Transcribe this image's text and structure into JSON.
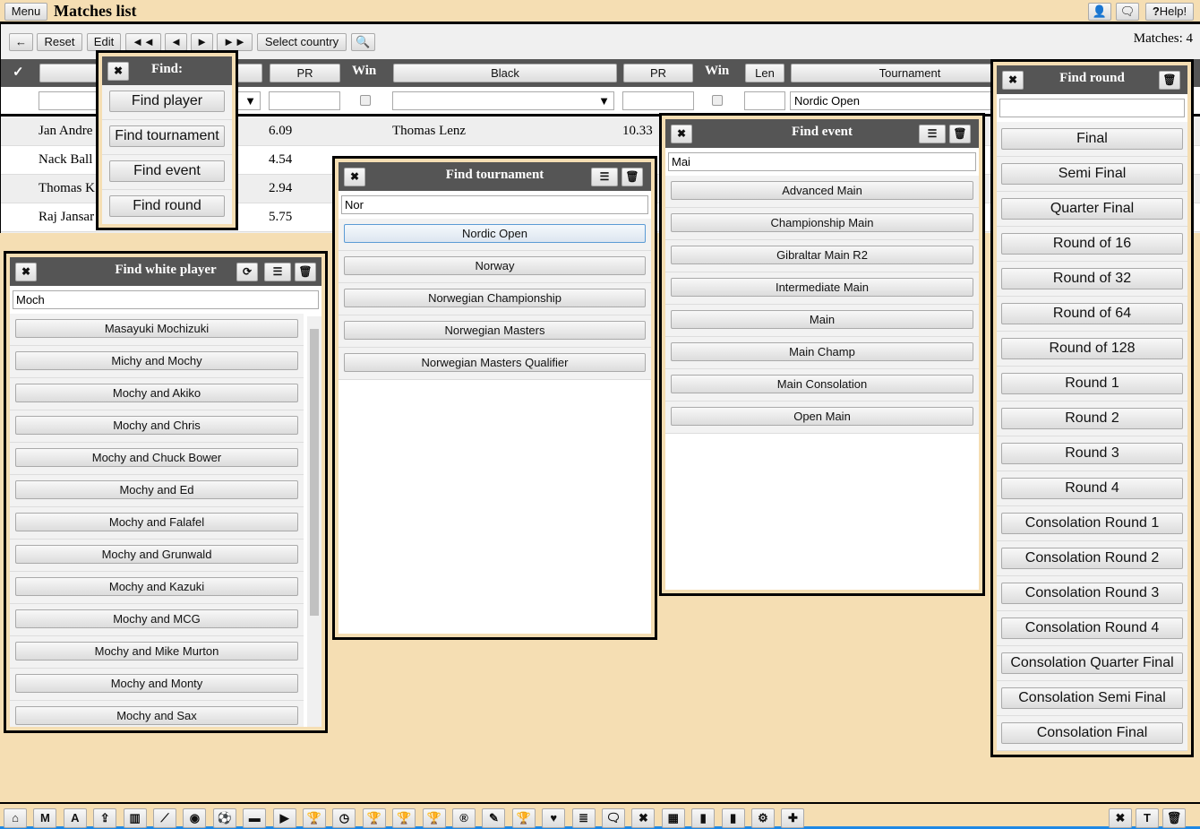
{
  "topbar": {
    "menu": "Menu",
    "title": "Matches list",
    "help": "Help!"
  },
  "toolbar": {
    "reset": "Reset",
    "edit": "Edit",
    "first": "◄◄",
    "prev": "◄",
    "next": "►",
    "last": "►►",
    "select_country": "Select country",
    "matches": "Matches: 4"
  },
  "columns": {
    "check": "✓",
    "pr": "PR",
    "win": "Win",
    "black": "Black",
    "pr2": "PR",
    "win2": "Win",
    "len": "Len",
    "tournament": "Tournament"
  },
  "filter": {
    "tournament": "Nordic Open"
  },
  "rows": [
    {
      "white": "Jan Andre",
      "pr": "6.09",
      "black": "Thomas Lenz",
      "pr2": "10.33"
    },
    {
      "white": "Nack Ball",
      "pr": "4.54"
    },
    {
      "white": "Thomas K",
      "pr": "2.94"
    },
    {
      "white": "Raj Jansar",
      "pr": "5.75"
    }
  ],
  "find_menu": {
    "title": "Find:",
    "items": [
      "Find player",
      "Find tournament",
      "Find event",
      "Find round"
    ]
  },
  "find_white": {
    "title": "Find white player",
    "query": "Moch",
    "items": [
      "Masayuki Mochizuki",
      "Michy and Mochy",
      "Mochy and Akiko",
      "Mochy and Chris",
      "Mochy and Chuck Bower",
      "Mochy and Ed",
      "Mochy and Falafel",
      "Mochy and Grunwald",
      "Mochy and Kazuki",
      "Mochy and MCG",
      "Mochy and Mike Murton",
      "Mochy and Monty",
      "Mochy and Sax"
    ]
  },
  "find_tournament": {
    "title": "Find tournament",
    "query": "Nor",
    "items": [
      "Nordic Open",
      "Norway",
      "Norwegian Championship",
      "Norwegian Masters",
      "Norwegian Masters Qualifier"
    ]
  },
  "find_event": {
    "title": "Find event",
    "query": "Mai",
    "items": [
      "Advanced Main",
      "Championship Main",
      "Gibraltar Main R2",
      "Intermediate Main",
      "Main",
      "Main Champ",
      "Main Consolation",
      "Open Main"
    ]
  },
  "find_round": {
    "title": "Find round",
    "query": "",
    "items": [
      "Final",
      "Semi Final",
      "Quarter Final",
      "Round of 16",
      "Round of 32",
      "Round of 64",
      "Round of 128",
      "Round 1",
      "Round 2",
      "Round 3",
      "Round 4",
      "Consolation Round 1",
      "Consolation Round 2",
      "Consolation Round 3",
      "Consolation Round 4",
      "Consolation Quarter Final",
      "Consolation Semi Final",
      "Consolation Final"
    ]
  },
  "bottom_icons": [
    "home",
    "M",
    "A",
    "upload",
    "bar-chart",
    "line-chart",
    "eye",
    "soccer",
    "archive",
    "play",
    "trophy",
    "clock",
    "trophy",
    "trophy",
    "trophy",
    "registered",
    "edit",
    "trophy",
    "heart",
    "database",
    "chat",
    "close",
    "film",
    "bookmark",
    "bookmark",
    "gears",
    "plus"
  ],
  "bottom_glyphs": [
    "⌂",
    "M",
    "A",
    "⇪",
    "▥",
    "⟋",
    "◉",
    "⚽",
    "▬",
    "▶",
    "🏆",
    "◷",
    "🏆",
    "🏆",
    "🏆",
    "®",
    "✎",
    "🏆",
    "♥",
    "≣",
    "🗨",
    "✖",
    "▦",
    "▮",
    "▮",
    "⚙",
    "✚"
  ],
  "bottom_right": {
    "close": "✖",
    "text": "T",
    "trash": "🗑"
  }
}
